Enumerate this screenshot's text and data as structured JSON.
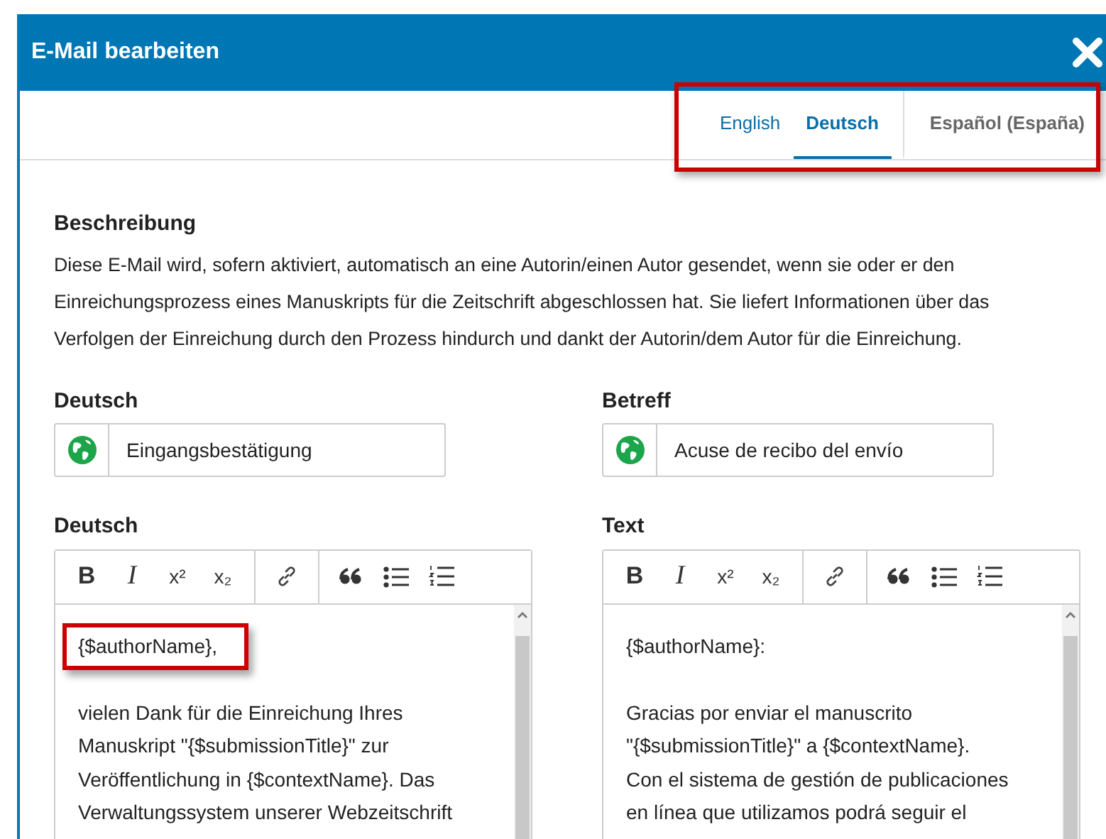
{
  "dialog": {
    "title": "E-Mail bearbeiten"
  },
  "language_tabs": {
    "highlighted": true,
    "tabs": [
      {
        "label": "English",
        "selected": false
      },
      {
        "label": "Deutsch",
        "selected": true
      },
      {
        "label": "Español (España)",
        "selected": false
      }
    ]
  },
  "description": {
    "heading": "Beschreibung",
    "text": "Diese E-Mail wird, sofern aktiviert, automatisch an eine Autorin/einen Autor gesendet, wenn sie oder er den Einreichungsprozess eines Manuskripts für die Zeitschrift abgeschlossen hat. Sie liefert Informationen über das Verfolgen der Einreichung durch den Prozess hindurch und dankt der Autorin/dem Autor für die Einreichung."
  },
  "fields": [
    {
      "label": "Deutsch",
      "value": "Eingangsbestätigung"
    },
    {
      "label": "Betreff",
      "value": "Acuse de recibo del envío"
    }
  ],
  "editors": [
    {
      "label": "Deutsch",
      "toolbar": [
        [
          {
            "kind": "bold",
            "label": "B"
          },
          {
            "kind": "italic",
            "label": "I"
          },
          {
            "kind": "superscript",
            "label": "x²"
          },
          {
            "kind": "subscript",
            "label": "x₂"
          }
        ],
        [
          {
            "kind": "link"
          }
        ],
        [
          {
            "kind": "quote"
          },
          {
            "kind": "bullet-list"
          },
          {
            "kind": "numbered-list"
          }
        ]
      ],
      "paragraphs": [
        {
          "highlighted": true,
          "lines": [
            "{$authorName},"
          ]
        },
        {
          "highlighted": false,
          "lines": [
            "vielen Dank für die Einreichung Ihres",
            "Manuskript \"{$submissionTitle}\" zur",
            "Veröffentlichung in {$contextName}. Das",
            "Verwaltungssystem unserer Webzeitschrift"
          ]
        }
      ]
    },
    {
      "label": "Text",
      "toolbar": [
        [
          {
            "kind": "bold",
            "label": "B"
          },
          {
            "kind": "italic",
            "label": "I"
          },
          {
            "kind": "superscript",
            "label": "x²"
          },
          {
            "kind": "subscript",
            "label": "x₂"
          }
        ],
        [
          {
            "kind": "link"
          }
        ],
        [
          {
            "kind": "quote"
          },
          {
            "kind": "bullet-list"
          },
          {
            "kind": "numbered-list"
          }
        ]
      ],
      "paragraphs": [
        {
          "highlighted": false,
          "lines": [
            "{$authorName}:"
          ]
        },
        {
          "highlighted": false,
          "lines": [
            "Gracias por enviar el manuscrito",
            "\"{$submissionTitle}\" a {$contextName}.",
            "Con el sistema de gestión de publicaciones",
            "en línea que utilizamos podrá seguir el"
          ]
        }
      ]
    }
  ]
}
